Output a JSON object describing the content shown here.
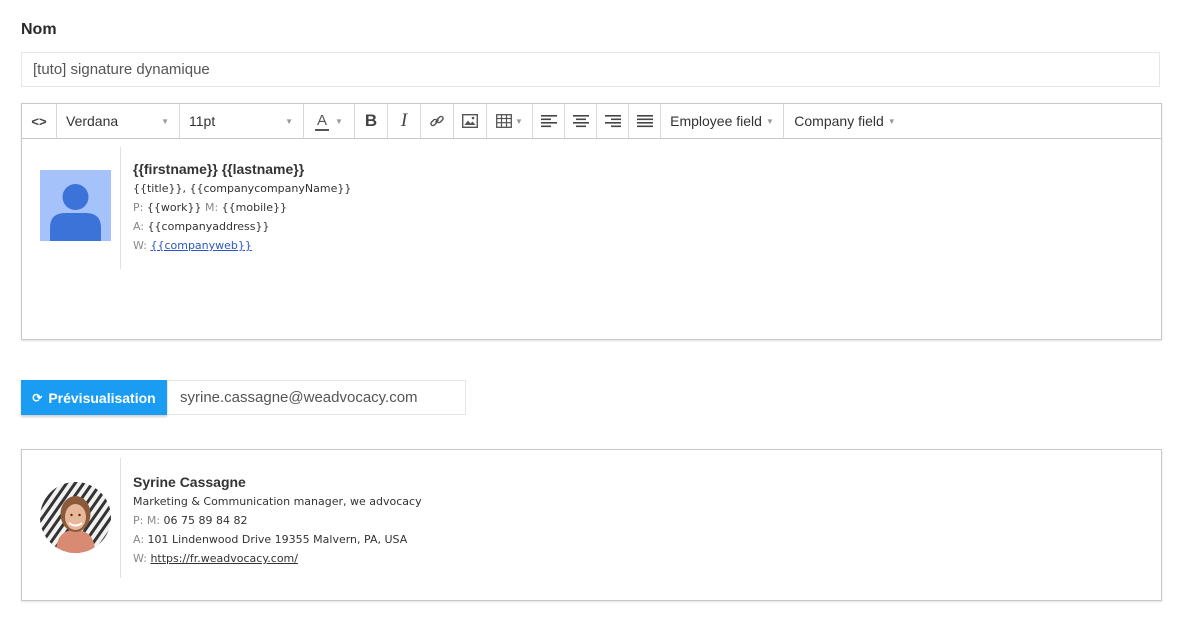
{
  "form": {
    "name_label": "Nom",
    "name_value": "[tuto] signature dynamique"
  },
  "toolbar": {
    "code_icon": "<>",
    "font_family": "Verdana",
    "font_size": "11pt",
    "font_color_icon": "text-color-icon",
    "bold_icon": "B",
    "italic_icon": "I",
    "employee_field": "Employee field",
    "company_field": "Company field"
  },
  "template_signature": {
    "name": "{{firstname}} {{lastname}}",
    "title": "{{title}}, {{companycompanyName}}",
    "phone_label_p": "P:",
    "phone_work": "{{work}}",
    "phone_label_m": "M:",
    "phone_mobile": "{{mobile}}",
    "address_label": "A:",
    "address": "{{companyaddress}}",
    "web_label": "W:",
    "web": "{{companyweb}}"
  },
  "preview": {
    "button_label": "Prévisualisation",
    "email_value": "syrine.cassagne@weadvocacy.com"
  },
  "rendered_signature": {
    "name": "Syrine Cassagne",
    "title": "Marketing & Communication manager, we advocacy",
    "phone_label_p": "P:",
    "phone_label_m": "M:",
    "phone_mobile": "06 75 89 84 82",
    "address_label": "A:",
    "address": "101 Lindenwood Drive 19355 Malvern, PA, USA",
    "web_label": "W:",
    "web": "https://fr.weadvocacy.com/"
  },
  "colors": {
    "accent": "#1a9cf2",
    "link": "#2a55c5",
    "avatar_bg": "#a5c2fb",
    "avatar_fg": "#3b73d9"
  }
}
